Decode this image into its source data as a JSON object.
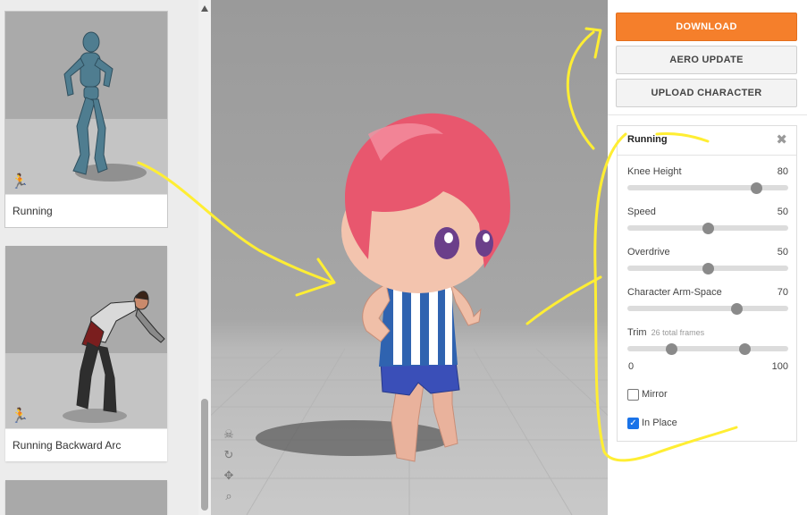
{
  "animations": [
    {
      "label": "Running",
      "icon": "running-person-icon",
      "active": true
    },
    {
      "label": "Running Backward Arc",
      "icon": "running-person-icon",
      "active": false
    },
    {
      "label": "",
      "icon": "",
      "active": false
    }
  ],
  "toolbar": {
    "download_label": "DOWNLOAD",
    "aero_label": "AERO UPDATE",
    "upload_label": "UPLOAD CHARACTER",
    "accent_color": "#f57f2b"
  },
  "settings": {
    "title": "Running",
    "close_glyph": "✖",
    "sliders": [
      {
        "name": "Knee Height",
        "value": "80",
        "fraction": 0.8
      },
      {
        "name": "Speed",
        "value": "50",
        "fraction": 0.5
      },
      {
        "name": "Overdrive",
        "value": "50",
        "fraction": 0.5
      },
      {
        "name": "Character Arm-Space",
        "value": "70",
        "fraction": 0.68
      }
    ],
    "trim": {
      "name": "Trim",
      "subtitle": "26 total frames",
      "min_label": "0",
      "max_label": "100",
      "start_fraction": 0.27,
      "end_fraction": 0.73
    },
    "mirror": {
      "label": "Mirror",
      "checked": false
    },
    "in_place": {
      "label": "In Place",
      "checked": true,
      "mark": "✓"
    }
  },
  "viewport_tools": [
    "skull-icon",
    "rotate-icon",
    "move-icon",
    "zoom-icon"
  ],
  "annotation_color": "#ffee33"
}
